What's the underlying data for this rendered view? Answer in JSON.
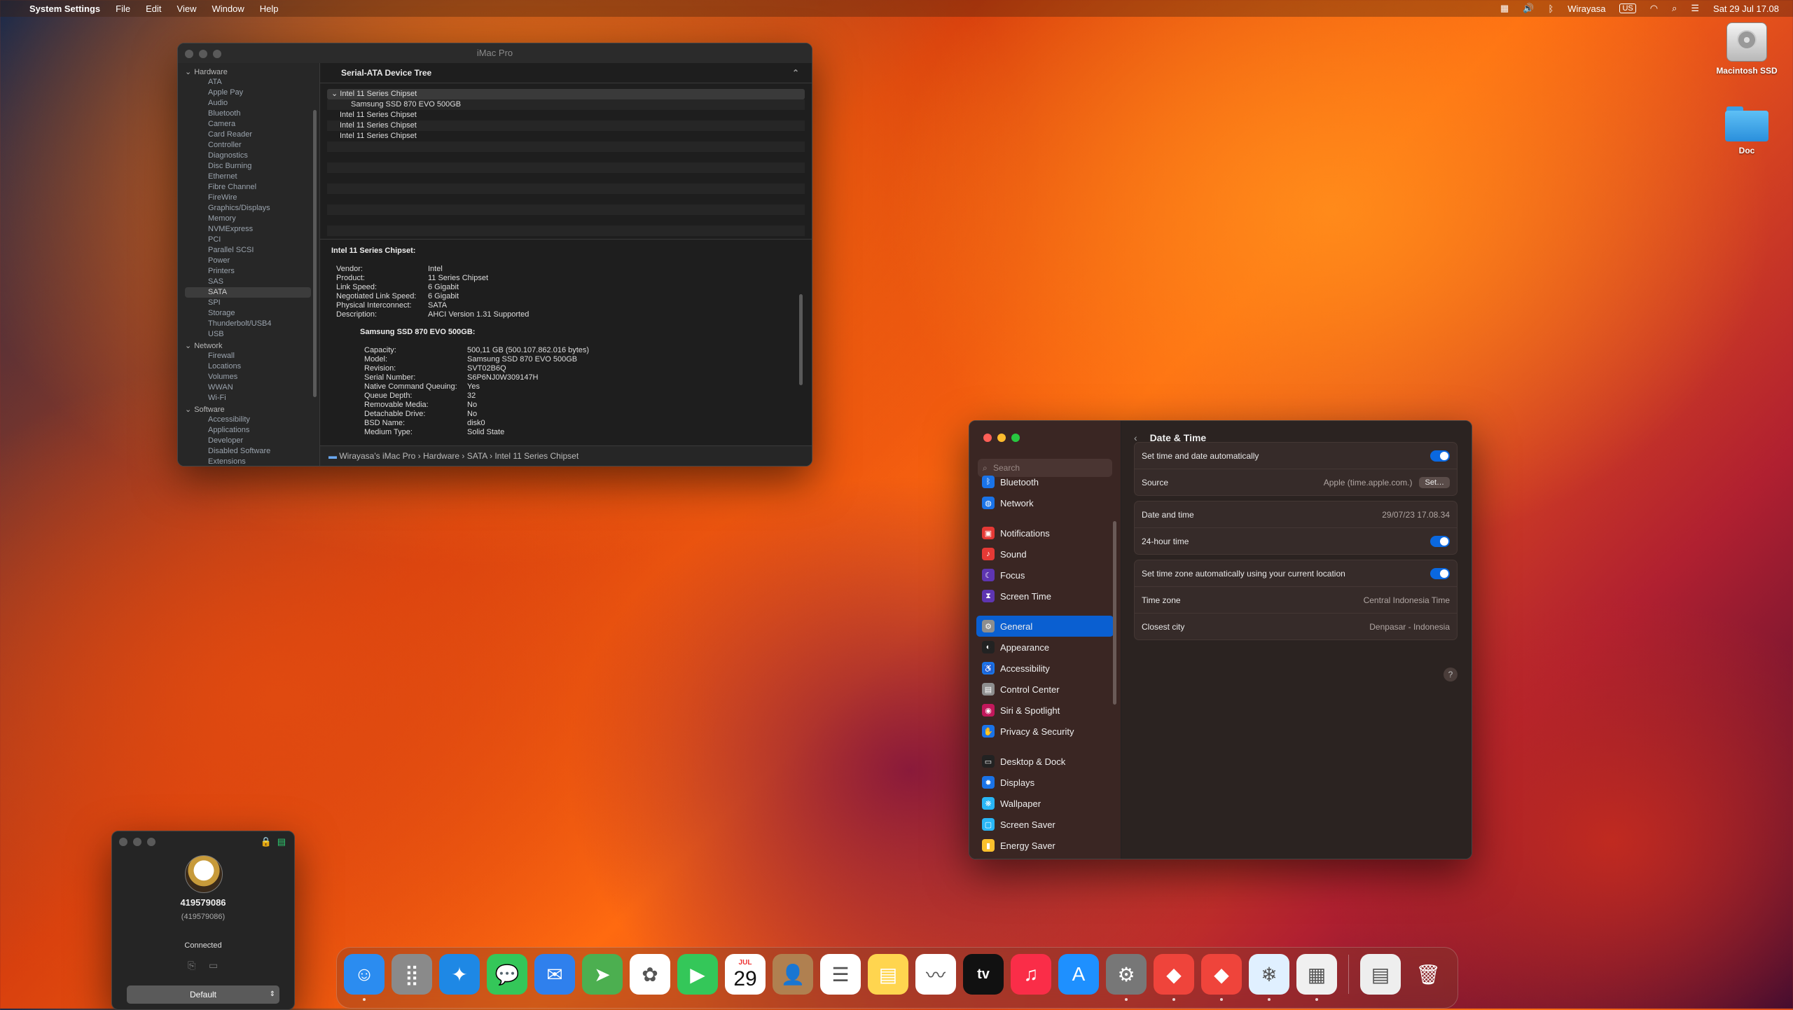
{
  "menubar": {
    "apple": "",
    "app_name": "System Settings",
    "menus": [
      "File",
      "Edit",
      "View",
      "Window",
      "Help"
    ],
    "user": "Wirayasa",
    "input_source": "US",
    "clock": "Sat 29 Jul  17.08"
  },
  "desktop": {
    "icons": [
      {
        "label": "Macintosh SSD",
        "icon": "hard-drive-icon"
      },
      {
        "label": "Doc",
        "icon": "folder-icon"
      }
    ]
  },
  "sysinfo": {
    "window_title": "iMac Pro",
    "sidebar": [
      {
        "group": "Hardware",
        "items": [
          "ATA",
          "Apple Pay",
          "Audio",
          "Bluetooth",
          "Camera",
          "Card Reader",
          "Controller",
          "Diagnostics",
          "Disc Burning",
          "Ethernet",
          "Fibre Channel",
          "FireWire",
          "Graphics/Displays",
          "Memory",
          "NVMExpress",
          "PCI",
          "Parallel SCSI",
          "Power",
          "Printers",
          "SAS",
          "SATA",
          "SPI",
          "Storage",
          "Thunderbolt/USB4",
          "USB"
        ]
      },
      {
        "group": "Network",
        "items": [
          "Firewall",
          "Locations",
          "Volumes",
          "WWAN",
          "Wi-Fi"
        ]
      },
      {
        "group": "Software",
        "items": [
          "Accessibility",
          "Applications",
          "Developer",
          "Disabled Software",
          "Extensions"
        ]
      }
    ],
    "selected_item": "SATA",
    "tree_header": "Serial-ATA Device Tree",
    "tree_rows": [
      {
        "label": "Intel 11 Series Chipset",
        "indent": 0,
        "expanded": true
      },
      {
        "label": "Samsung SSD 870 EVO 500GB",
        "indent": 1
      },
      {
        "label": "Intel 11 Series Chipset",
        "indent": 0
      },
      {
        "label": "Intel 11 Series Chipset",
        "indent": 0
      },
      {
        "label": "Intel 11 Series Chipset",
        "indent": 0
      }
    ],
    "detail_title": "Intel 11 Series Chipset:",
    "detail_fields": [
      {
        "k": "Vendor:",
        "v": "Intel"
      },
      {
        "k": "Product:",
        "v": "11 Series Chipset"
      },
      {
        "k": "Link Speed:",
        "v": "6 Gigabit"
      },
      {
        "k": "Negotiated Link Speed:",
        "v": "6 Gigabit"
      },
      {
        "k": "Physical Interconnect:",
        "v": "SATA"
      },
      {
        "k": "Description:",
        "v": "AHCI Version 1.31 Supported"
      }
    ],
    "device_title": "Samsung SSD 870 EVO 500GB:",
    "device_fields": [
      {
        "k": "Capacity:",
        "v": "500,11 GB (500.107.862.016 bytes)"
      },
      {
        "k": "Model:",
        "v": "Samsung SSD 870 EVO 500GB"
      },
      {
        "k": "Revision:",
        "v": "SVT02B6Q"
      },
      {
        "k": "Serial Number:",
        "v": "S6P6NJ0W309147H"
      },
      {
        "k": "Native Command Queuing:",
        "v": "Yes"
      },
      {
        "k": "Queue Depth:",
        "v": "32"
      },
      {
        "k": "Removable Media:",
        "v": "No"
      },
      {
        "k": "Detachable Drive:",
        "v": "No"
      },
      {
        "k": "BSD Name:",
        "v": "disk0"
      },
      {
        "k": "Medium Type:",
        "v": "Solid State"
      }
    ],
    "pathbar": [
      "Wirayasa's iMac Pro",
      "Hardware",
      "SATA",
      "Intel 11 Series Chipset"
    ]
  },
  "settings": {
    "search_placeholder": "Search",
    "nav": [
      {
        "label": "Bluetooth",
        "color": "#1a73e8",
        "glyph": "ᛒ"
      },
      {
        "label": "Network",
        "color": "#1a73e8",
        "glyph": "◍"
      },
      {
        "gap": true
      },
      {
        "label": "Notifications",
        "color": "#e53935",
        "glyph": "▣"
      },
      {
        "label": "Sound",
        "color": "#e53935",
        "glyph": "♪"
      },
      {
        "label": "Focus",
        "color": "#5e35b1",
        "glyph": "☾"
      },
      {
        "label": "Screen Time",
        "color": "#5e35b1",
        "glyph": "⧗"
      },
      {
        "gap": true
      },
      {
        "label": "General",
        "color": "#8e8e8e",
        "glyph": "⚙",
        "selected": true
      },
      {
        "label": "Appearance",
        "color": "#222222",
        "glyph": "◐"
      },
      {
        "label": "Accessibility",
        "color": "#1a73e8",
        "glyph": "♿"
      },
      {
        "label": "Control Center",
        "color": "#8e8e8e",
        "glyph": "▤"
      },
      {
        "label": "Siri & Spotlight",
        "color": "#c2185b",
        "glyph": "◉"
      },
      {
        "label": "Privacy & Security",
        "color": "#1a73e8",
        "glyph": "✋"
      },
      {
        "gap": true
      },
      {
        "label": "Desktop & Dock",
        "color": "#222222",
        "glyph": "▭"
      },
      {
        "label": "Displays",
        "color": "#1a73e8",
        "glyph": "✹"
      },
      {
        "label": "Wallpaper",
        "color": "#29b6f6",
        "glyph": "❋"
      },
      {
        "label": "Screen Saver",
        "color": "#29b6f6",
        "glyph": "▢"
      },
      {
        "label": "Energy Saver",
        "color": "#fbc02d",
        "glyph": "▮"
      }
    ],
    "page_title": "Date & Time",
    "groups": [
      {
        "rows": [
          {
            "label": "Set time and date automatically",
            "toggle": true
          },
          {
            "label": "Source",
            "value": "Apple (time.apple.com.)",
            "button": "Set…"
          }
        ]
      },
      {
        "rows": [
          {
            "label": "Date and time",
            "value": "29/07/23 17.08.34"
          },
          {
            "label": "24-hour time",
            "toggle": true
          }
        ]
      },
      {
        "rows": [
          {
            "label": "Set time zone automatically using your current location",
            "toggle": true
          },
          {
            "label": "Time zone",
            "value": "Central Indonesia Time"
          },
          {
            "label": "Closest city",
            "value": "Denpasar - Indonesia"
          }
        ]
      }
    ],
    "help": "?"
  },
  "remote": {
    "id": "419579086",
    "id_paren": "(419579086)",
    "status": "Connected",
    "profile": "Default"
  },
  "dock": {
    "items": [
      {
        "name": "Finder",
        "bg": "#2b8cf0",
        "glyph": "☺",
        "running": true
      },
      {
        "name": "Launchpad",
        "bg": "#8a8a8a",
        "glyph": "⣿"
      },
      {
        "name": "Safari",
        "bg": "#1e88e5",
        "glyph": "✦"
      },
      {
        "name": "Messages",
        "bg": "#34c759",
        "glyph": "💬"
      },
      {
        "name": "Mail",
        "bg": "#2f80ed",
        "glyph": "✉"
      },
      {
        "name": "Maps",
        "bg": "#4caf50",
        "glyph": "➤"
      },
      {
        "name": "Photos",
        "bg": "#ffffff",
        "glyph": "✿"
      },
      {
        "name": "FaceTime",
        "bg": "#34c759",
        "glyph": "▶"
      },
      {
        "name": "Calendar",
        "calendar": true,
        "month": "JUL",
        "day": "29"
      },
      {
        "name": "Contacts",
        "bg": "#b08050",
        "glyph": "👤"
      },
      {
        "name": "Reminders",
        "bg": "#ffffff",
        "glyph": "☰"
      },
      {
        "name": "Notes",
        "bg": "#ffd54f",
        "glyph": "▤"
      },
      {
        "name": "Freeform",
        "bg": "#ffffff",
        "glyph": "〰"
      },
      {
        "name": "TV",
        "bg": "#111111",
        "glyph": "tv"
      },
      {
        "name": "Music",
        "bg": "#fa2d48",
        "glyph": "♫"
      },
      {
        "name": "App Store",
        "bg": "#1e90ff",
        "glyph": "A"
      },
      {
        "name": "System Settings",
        "bg": "#777777",
        "glyph": "⚙",
        "running": true
      },
      {
        "name": "AnyDesk",
        "bg": "#ef443b",
        "glyph": "◆",
        "running": true
      },
      {
        "name": "AnyDesk 2",
        "bg": "#ef443b",
        "glyph": "◆",
        "running": true
      },
      {
        "name": "Preview",
        "bg": "#e0f0ff",
        "glyph": "❄",
        "running": true
      },
      {
        "name": "System Information",
        "bg": "#f0f0f0",
        "glyph": "▦",
        "running": true
      },
      {
        "sep": true
      },
      {
        "name": "Documents",
        "bg": "#eeeeee",
        "glyph": "▤"
      },
      {
        "name": "Trash",
        "bg": "transparent",
        "glyph": "🗑"
      }
    ]
  }
}
